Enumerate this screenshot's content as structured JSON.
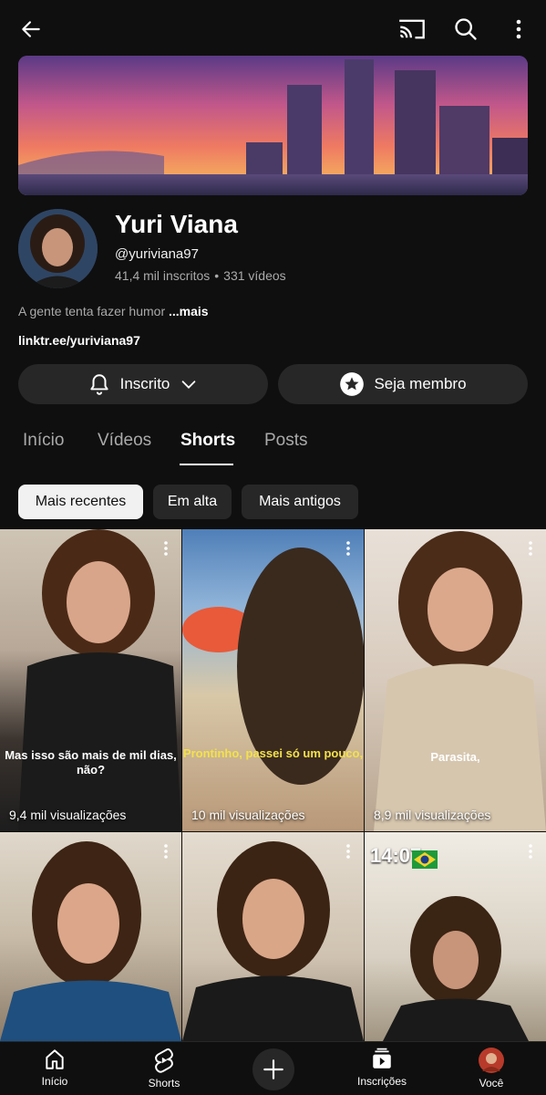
{
  "channel": {
    "name": "Yuri Viana",
    "handle": "@yuriviana97",
    "subscribers": "41,4 mil inscritos",
    "videos": "331 vídeos",
    "description": "A gente tenta fazer humor ",
    "more": "...mais",
    "link": "linktr.ee/yuriviana97"
  },
  "buttons": {
    "subscribed": "Inscrito",
    "member": "Seja membro"
  },
  "tabs": [
    "Início",
    "Vídeos",
    "Shorts",
    "Posts"
  ],
  "active_tab": "Shorts",
  "chips": [
    "Mais recentes",
    "Em alta",
    "Mais antigos"
  ],
  "selected_chip": "Mais recentes",
  "shorts": [
    {
      "views": "9,4 mil visualizações",
      "caption": "Mas isso são mais de mil dias, não?"
    },
    {
      "views": "10 mil visualizações",
      "caption": "Prontinho, passei só um pouco,"
    },
    {
      "views": "8,9 mil visualizações",
      "caption": "Parasita,"
    },
    {
      "views": "",
      "caption": ""
    },
    {
      "views": "",
      "caption": ""
    },
    {
      "views": "",
      "caption": "14:07"
    }
  ],
  "nav": {
    "home": "Início",
    "shorts": "Shorts",
    "subscriptions": "Inscrições",
    "you": "Você"
  },
  "colors": {
    "background": "#0f0f0f",
    "surface": "#272727",
    "chip_selected": "#f1f1f1",
    "secondary_text": "#aaaaaa"
  }
}
